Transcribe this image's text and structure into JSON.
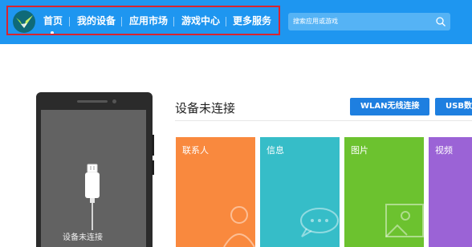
{
  "nav": {
    "items": [
      {
        "label": "首页",
        "active": true
      },
      {
        "label": "我的设备"
      },
      {
        "label": "应用市场"
      },
      {
        "label": "游戏中心"
      },
      {
        "label": "更多服务"
      }
    ]
  },
  "search": {
    "placeholder": "搜索应用或游戏",
    "icon": "search-icon"
  },
  "device": {
    "status_text": "设备未连接"
  },
  "main": {
    "title": "设备未连接",
    "buttons": [
      {
        "label": "WLAN无线连接"
      },
      {
        "label": "USB数据线连接"
      }
    ],
    "tiles": [
      {
        "label": "联系人",
        "color": "#f9893e"
      },
      {
        "label": "信息",
        "color": "#36bdc8"
      },
      {
        "label": "图片",
        "color": "#6cc22f"
      },
      {
        "label": "视频",
        "color": "#9b63d6"
      }
    ]
  },
  "colors": {
    "topbar": "#1e96f0",
    "highlight": "#d8242f",
    "button": "#1e7fe0"
  }
}
